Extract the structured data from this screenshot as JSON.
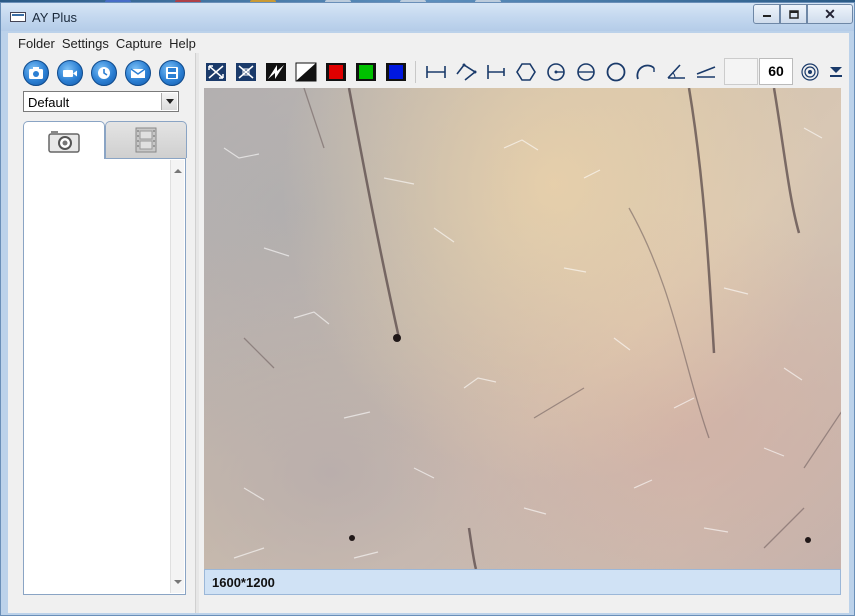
{
  "window": {
    "title": "AY Plus"
  },
  "menu": [
    "Folder",
    "Settings",
    "Capture",
    "Help"
  ],
  "quick_buttons": [
    "camera-icon",
    "video-camera-icon",
    "timer-icon",
    "mail-icon",
    "save-icon"
  ],
  "profile_select": {
    "value": "Default"
  },
  "media_tabs": [
    {
      "name": "photos",
      "icon": "camera-icon",
      "selected": true
    },
    {
      "name": "videos",
      "icon": "film-icon",
      "selected": false
    }
  ],
  "toolbar": {
    "tools": [
      "fit-window-icon",
      "actual-size-icon",
      "invert-icon",
      "black-white-icon",
      "red-channel-icon",
      "green-channel-icon",
      "blue-channel-icon",
      "line-measure-icon",
      "polyline-measure-icon",
      "perpendicular-measure-icon",
      "polygon-measure-icon",
      "circle-center-icon",
      "circle-diameter-icon",
      "circle-three-point-icon",
      "arc-measure-icon",
      "angle-measure-icon",
      "line-angle-icon"
    ],
    "magnification_value": "60",
    "calibration_icon": "target-icon",
    "more_icon": "chevron-down-icon"
  },
  "colors": {
    "red": "#e00000",
    "green": "#00c000",
    "blue": "#0018e0",
    "accent": "#2b7fd3"
  },
  "status": {
    "resolution": "1600*1200"
  }
}
